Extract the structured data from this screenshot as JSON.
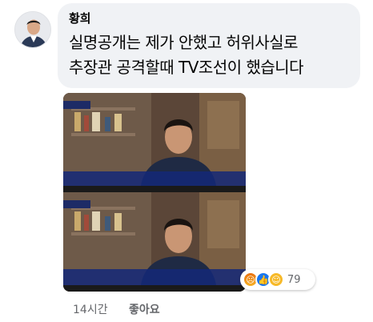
{
  "comment": {
    "author": "황희",
    "text_line1": "실명공개는 제가 안했고 허위사실로",
    "text_line2": "추장관 공격할때 TV조선이 했습니다",
    "time": "14시간",
    "like_label": "좋아요",
    "reaction_count": "79",
    "reactions": [
      "angry-icon",
      "like-icon",
      "haha-icon"
    ]
  },
  "colors": {
    "bubble": "#f0f2f5",
    "like_blue": "#1877f2",
    "meta_gray": "#65676b"
  }
}
